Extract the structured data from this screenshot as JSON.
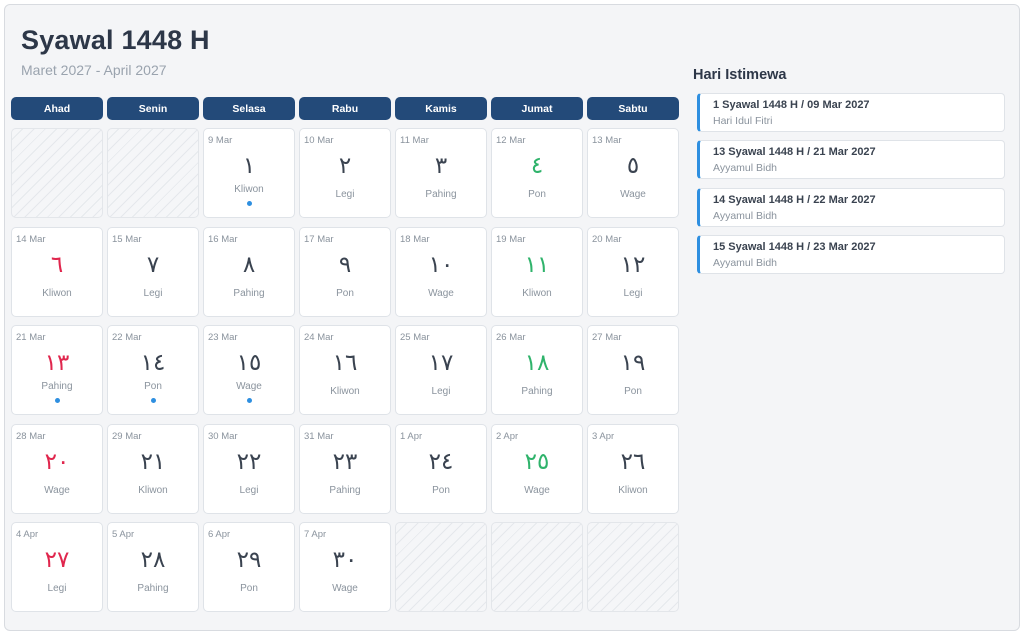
{
  "header": {
    "title": "Syawal 1448 H",
    "subtitle": "Maret 2027 - April 2027"
  },
  "weekdays": [
    "Ahad",
    "Senin",
    "Selasa",
    "Rabu",
    "Kamis",
    "Jumat",
    "Sabtu"
  ],
  "colors": {
    "header_bg": "#234a79",
    "holiday_red": "#e0264d",
    "friday_green": "#2fb36b",
    "event_blue": "#2e8fe0"
  },
  "calendar": [
    {
      "empty": true
    },
    {
      "empty": true
    },
    {
      "greg": "9 Mar",
      "hijri": "١",
      "pasaran": "Kliwon",
      "marker": true
    },
    {
      "greg": "10 Mar",
      "hijri": "٢",
      "pasaran": "Legi"
    },
    {
      "greg": "11 Mar",
      "hijri": "٣",
      "pasaran": "Pahing"
    },
    {
      "greg": "12 Mar",
      "hijri": "٤",
      "pasaran": "Pon",
      "color": "green"
    },
    {
      "greg": "13 Mar",
      "hijri": "٥",
      "pasaran": "Wage"
    },
    {
      "greg": "14 Mar",
      "hijri": "٦",
      "pasaran": "Kliwon",
      "color": "red"
    },
    {
      "greg": "15 Mar",
      "hijri": "٧",
      "pasaran": "Legi"
    },
    {
      "greg": "16 Mar",
      "hijri": "٨",
      "pasaran": "Pahing"
    },
    {
      "greg": "17 Mar",
      "hijri": "٩",
      "pasaran": "Pon"
    },
    {
      "greg": "18 Mar",
      "hijri": "١٠",
      "pasaran": "Wage"
    },
    {
      "greg": "19 Mar",
      "hijri": "١١",
      "pasaran": "Kliwon",
      "color": "green"
    },
    {
      "greg": "20 Mar",
      "hijri": "١٢",
      "pasaran": "Legi"
    },
    {
      "greg": "21 Mar",
      "hijri": "١٣",
      "pasaran": "Pahing",
      "color": "red",
      "marker": true
    },
    {
      "greg": "22 Mar",
      "hijri": "١٤",
      "pasaran": "Pon",
      "marker": true
    },
    {
      "greg": "23 Mar",
      "hijri": "١٥",
      "pasaran": "Wage",
      "marker": true
    },
    {
      "greg": "24 Mar",
      "hijri": "١٦",
      "pasaran": "Kliwon"
    },
    {
      "greg": "25 Mar",
      "hijri": "١٧",
      "pasaran": "Legi"
    },
    {
      "greg": "26 Mar",
      "hijri": "١٨",
      "pasaran": "Pahing",
      "color": "green"
    },
    {
      "greg": "27 Mar",
      "hijri": "١٩",
      "pasaran": "Pon"
    },
    {
      "greg": "28 Mar",
      "hijri": "٢٠",
      "pasaran": "Wage",
      "color": "red"
    },
    {
      "greg": "29 Mar",
      "hijri": "٢١",
      "pasaran": "Kliwon"
    },
    {
      "greg": "30 Mar",
      "hijri": "٢٢",
      "pasaran": "Legi"
    },
    {
      "greg": "31 Mar",
      "hijri": "٢٣",
      "pasaran": "Pahing"
    },
    {
      "greg": "1 Apr",
      "hijri": "٢٤",
      "pasaran": "Pon"
    },
    {
      "greg": "2 Apr",
      "hijri": "٢٥",
      "pasaran": "Wage",
      "color": "green"
    },
    {
      "greg": "3 Apr",
      "hijri": "٢٦",
      "pasaran": "Kliwon"
    },
    {
      "greg": "4 Apr",
      "hijri": "٢٧",
      "pasaran": "Legi",
      "color": "red"
    },
    {
      "greg": "5 Apr",
      "hijri": "٢٨",
      "pasaran": "Pahing"
    },
    {
      "greg": "6 Apr",
      "hijri": "٢٩",
      "pasaran": "Pon"
    },
    {
      "greg": "7 Apr",
      "hijri": "٣٠",
      "pasaran": "Wage"
    },
    {
      "empty": true
    },
    {
      "empty": true
    },
    {
      "empty": true
    }
  ],
  "special_days": {
    "title": "Hari Istimewa",
    "items": [
      {
        "title": "1 Syawal 1448 H / 09 Mar 2027",
        "desc": "Hari Idul Fitri"
      },
      {
        "title": "13 Syawal 1448 H / 21 Mar 2027",
        "desc": "Ayyamul Bidh"
      },
      {
        "title": "14 Syawal 1448 H / 22 Mar 2027",
        "desc": "Ayyamul Bidh"
      },
      {
        "title": "15 Syawal 1448 H / 23 Mar 2027",
        "desc": "Ayyamul Bidh"
      }
    ]
  }
}
